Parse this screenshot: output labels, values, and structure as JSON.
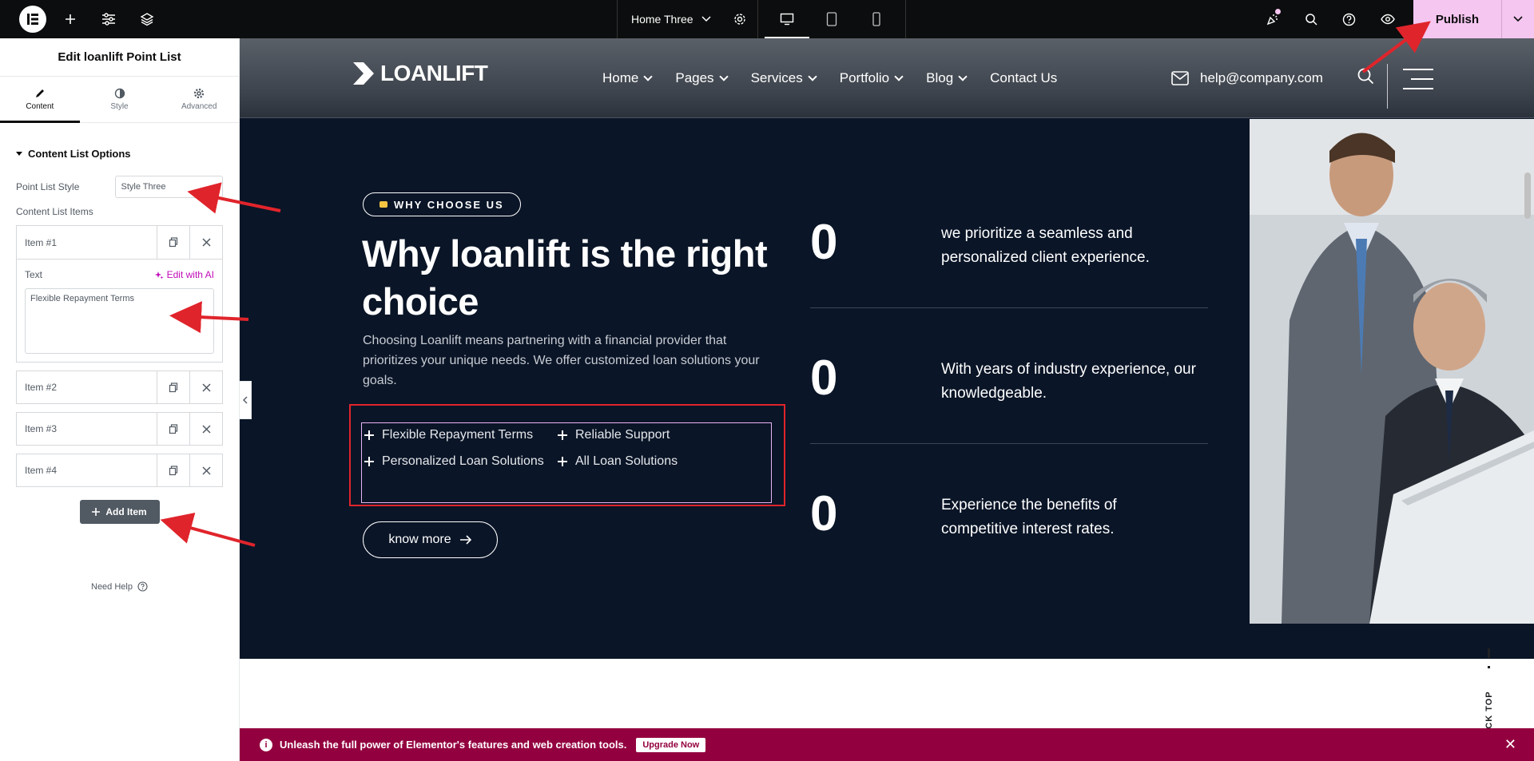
{
  "topbar": {
    "page_name": "Home Three",
    "publish_label": "Publish"
  },
  "panel": {
    "title": "Edit loanlift Point List",
    "tabs": [
      {
        "label": "Content",
        "icon": "pencil-icon",
        "active": true
      },
      {
        "label": "Style",
        "icon": "half-circle-icon",
        "active": false
      },
      {
        "label": "Advanced",
        "icon": "gear-icon",
        "active": false
      }
    ],
    "section_title": "Content List Options",
    "point_list_style_label": "Point List Style",
    "point_list_style_value": "Style Three",
    "content_list_items_label": "Content List Items",
    "items": [
      {
        "title": "Item #1",
        "open": true
      },
      {
        "title": "Item #2",
        "open": false
      },
      {
        "title": "Item #3",
        "open": false
      },
      {
        "title": "Item #4",
        "open": false
      }
    ],
    "text_label": "Text",
    "edit_with_ai": "Edit with AI",
    "text_value": "Flexible Repayment Terms",
    "add_item": "Add Item",
    "need_help": "Need Help"
  },
  "site": {
    "logo": "LOANLIFT",
    "nav": [
      "Home",
      "Pages",
      "Services",
      "Portfolio",
      "Blog",
      "Contact Us"
    ],
    "email": "help@company.com",
    "badge": "WHY CHOOSE US",
    "title": "Why loanlift is the right choice",
    "description": "Choosing Loanlift means partnering with a financial provider that prioritizes your unique needs. We offer customized loan solutions your goals.",
    "points": [
      "Flexible Repayment Terms",
      "Reliable Support",
      "Personalized Loan Solutions",
      "All Loan Solutions"
    ],
    "cta": "know more",
    "stats": [
      {
        "number": "0",
        "text": "we prioritize a seamless and personalized client experience."
      },
      {
        "number": "0",
        "text": "With years of industry experience, our knowledgeable."
      },
      {
        "number": "0",
        "text": "Experience the benefits of competitive interest rates."
      }
    ],
    "back_top": "BACK TOP"
  },
  "promo": {
    "text": "Unleash the full power of Elementor's features and web creation tools.",
    "upgrade": "Upgrade Now"
  },
  "colors": {
    "hero_bg": "#0a1527",
    "publish_bg": "#f5c6f0",
    "promo_bg": "#93003f",
    "annotation_red": "#e0242b"
  }
}
